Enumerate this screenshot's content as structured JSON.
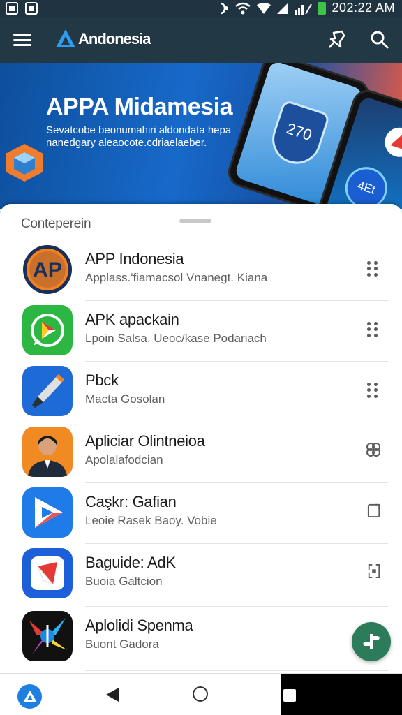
{
  "status_bar": {
    "time": "202:22 AM"
  },
  "app_bar": {
    "title": "Andonesia"
  },
  "hero": {
    "title": "APPA Midamesia",
    "subtitle": "Sevatcobe beonumahiri aldondata hepa nanedgary aleaocote.cdriaelaeber.",
    "phone_screen_text": "270",
    "phone_badge_text": "4Et"
  },
  "sheet": {
    "section_label": "Conteperein",
    "apps": [
      {
        "name": "APP Indonesia",
        "desc": "Applass.'fiamacsol Vnanegt. Kiana",
        "icon": "ap-logo-icon",
        "action": "drag-dots-icon"
      },
      {
        "name": "APK apackain",
        "desc": "Lpoin Salsa. Ueoc/kase Podariach",
        "icon": "whatsapp-play-icon",
        "action": "drag-dots-icon"
      },
      {
        "name": "Pbck",
        "desc": "Macta Gosolan",
        "icon": "paintbrush-icon",
        "action": "drag-dots-icon"
      },
      {
        "name": "Apliciar Olintneioa",
        "desc": "Apolalafodcian",
        "icon": "profile-photo-icon",
        "action": "clover-icon"
      },
      {
        "name": "Caşkr: Gafian",
        "desc": "Leoie Rasek Baoy. Vobie",
        "icon": "play-triangle-icon",
        "action": "copy-icon"
      },
      {
        "name": "Baguide: AdK",
        "desc": "Buoia Galtcion",
        "icon": "bookmark-app-icon",
        "action": "bracket-icon"
      },
      {
        "name": "Aplolidi Spenma",
        "desc": "Buont Gadora",
        "icon": "colorful-burst-icon",
        "action": ""
      }
    ]
  },
  "colors": {
    "app_bar": "#233845",
    "accent": "#1f7fe0",
    "fab": "#2c7b5a"
  }
}
